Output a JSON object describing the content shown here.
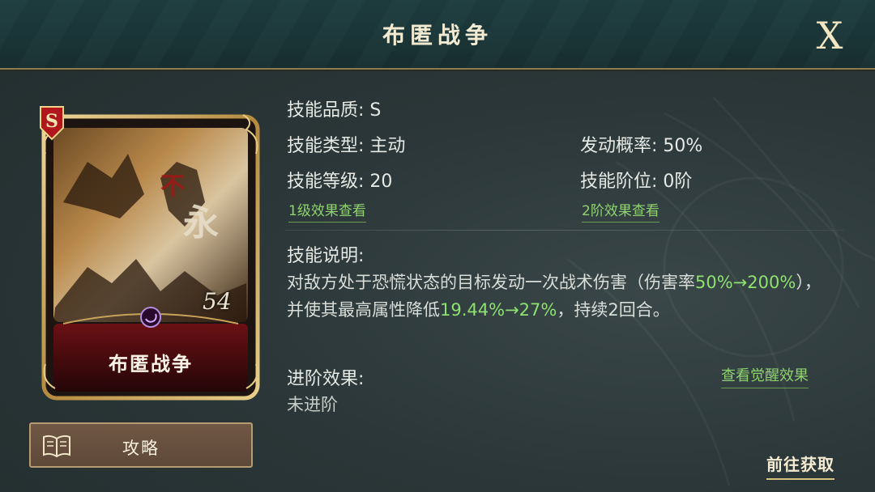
{
  "window": {
    "title": "布匿战争",
    "close_label": "X"
  },
  "card": {
    "grade": "S",
    "name": "布匿战争",
    "level_mark": "54",
    "art_icon": "battle-scene-art",
    "badge_icon": "sickle-icon"
  },
  "guide_button": {
    "label": "攻略",
    "icon": "book-icon"
  },
  "skill": {
    "quality_label": "技能品质: S",
    "type_label": "技能类型: 主动",
    "rate_label": "发动概率: 50%",
    "level_label": "技能等级: 20",
    "tier_label": "技能阶位: 0阶",
    "link_level1": "1级效果查看",
    "link_tier2": "2阶效果查看",
    "desc_title": "技能说明:",
    "desc_parts": {
      "p1": "对敌方处于恐慌状态的目标发动一次战术伤害（伤害率",
      "h1": "50%→200%",
      "p2": "），并使其最高属性降低",
      "h2": "19.44%→27%",
      "p3": "，持续2回合。"
    },
    "advance_title": "进阶效果:",
    "advance_link": "查看觉醒效果",
    "advance_value": "未进阶"
  },
  "footer": {
    "goto_label": "前往获取"
  },
  "colors": {
    "highlight": "#8de170",
    "link": "#8fd36e",
    "gold": "#c8a45a"
  }
}
